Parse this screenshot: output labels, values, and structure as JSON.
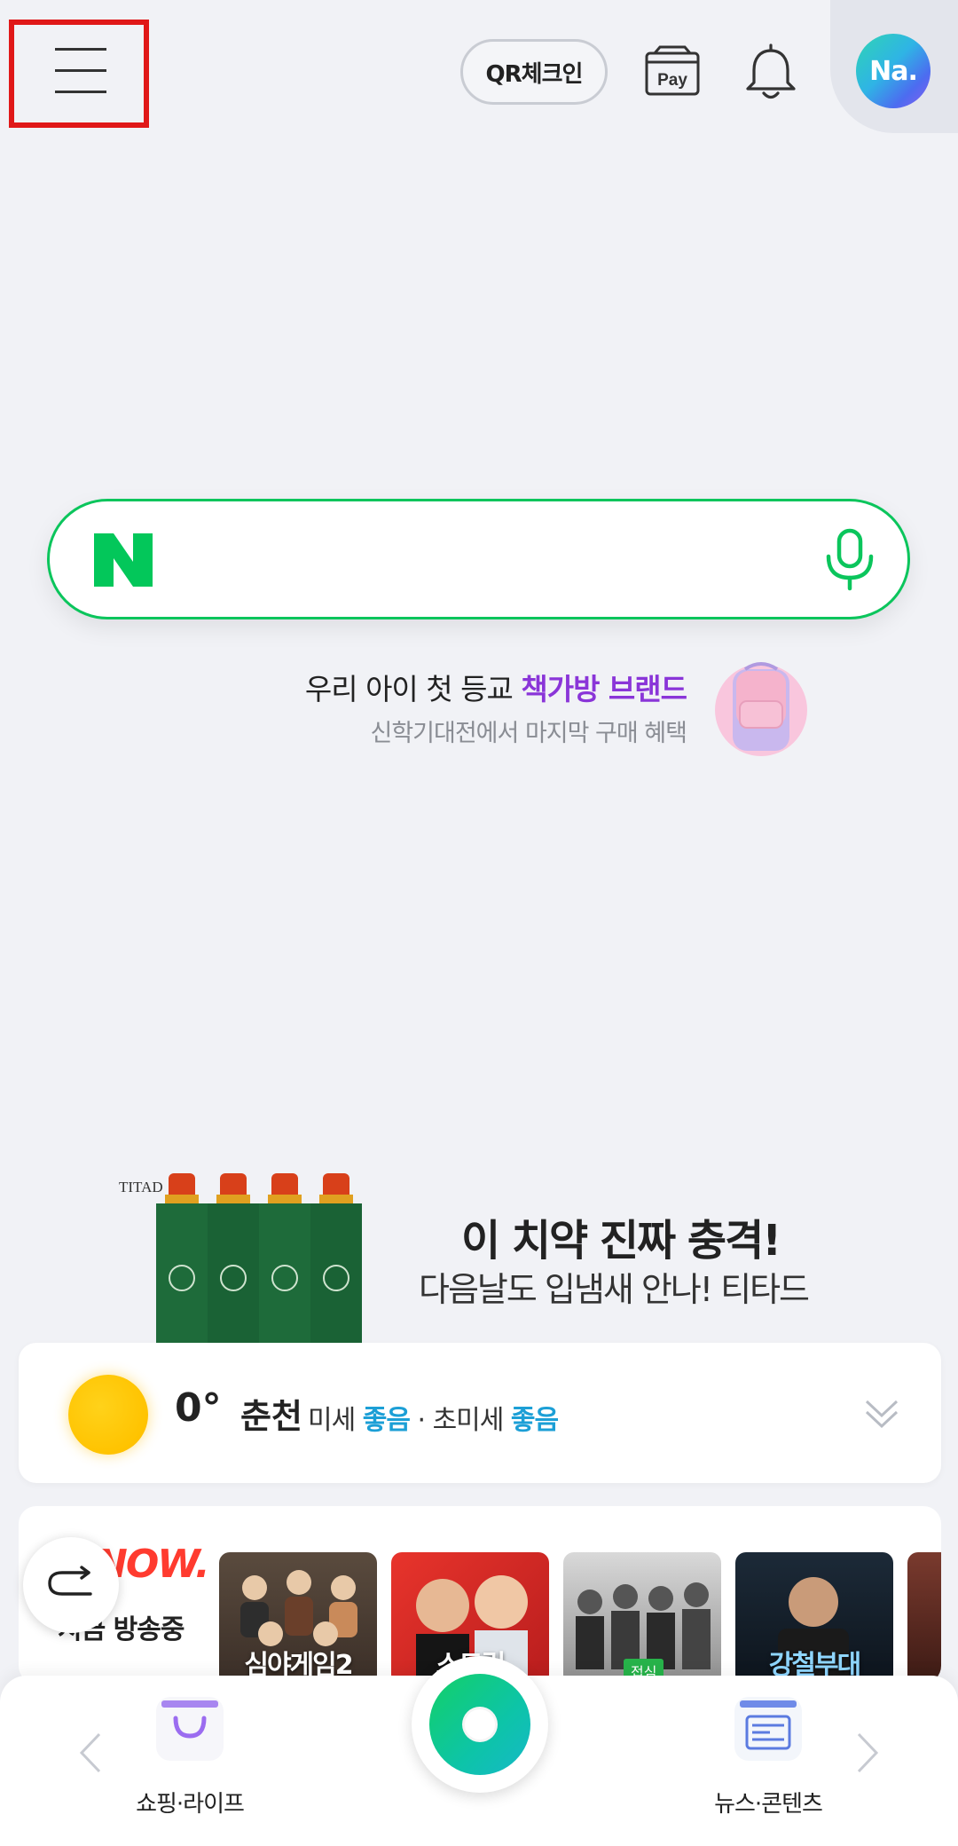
{
  "header": {
    "qr_checkin_label": "QR체크인",
    "pay_label": "Pay",
    "avatar_text": "Na.",
    "icons": [
      "menu-icon",
      "pay-icon",
      "bell-icon"
    ]
  },
  "search": {
    "logo": "N",
    "placeholder": "",
    "value": "",
    "colors": {
      "brand": "#03c75a"
    }
  },
  "promo": {
    "line1_prefix": "우리 아이 첫 등교 ",
    "line1_highlight": "책가방 브랜드",
    "line2": "신학기대전에서 마지막 구매 혜택"
  },
  "ad": {
    "brand": "TITAD",
    "title": "이 치약 진짜 충격!",
    "subtitle": "다음날도 입냄새 안나! 티타드"
  },
  "weather": {
    "temperature": "0°",
    "city": "춘천",
    "fine_dust_label": "미세",
    "fine_dust_value": "좋음",
    "separator": " · ",
    "ultra_fine_dust_label": "초미세",
    "ultra_fine_dust_value": "좋음"
  },
  "live": {
    "logo": "NOW.",
    "label": "지금 방송중",
    "thumbnails": [
      {
        "caption": "심야게임2"
      },
      {
        "caption": "스트릿"
      },
      {
        "caption": "",
        "badge": "접심"
      },
      {
        "caption": "강철부대"
      },
      {
        "caption": ""
      }
    ]
  },
  "bottom_nav": {
    "shop_label": "쇼핑·라이프",
    "news_label": "뉴스·콘텐츠"
  }
}
